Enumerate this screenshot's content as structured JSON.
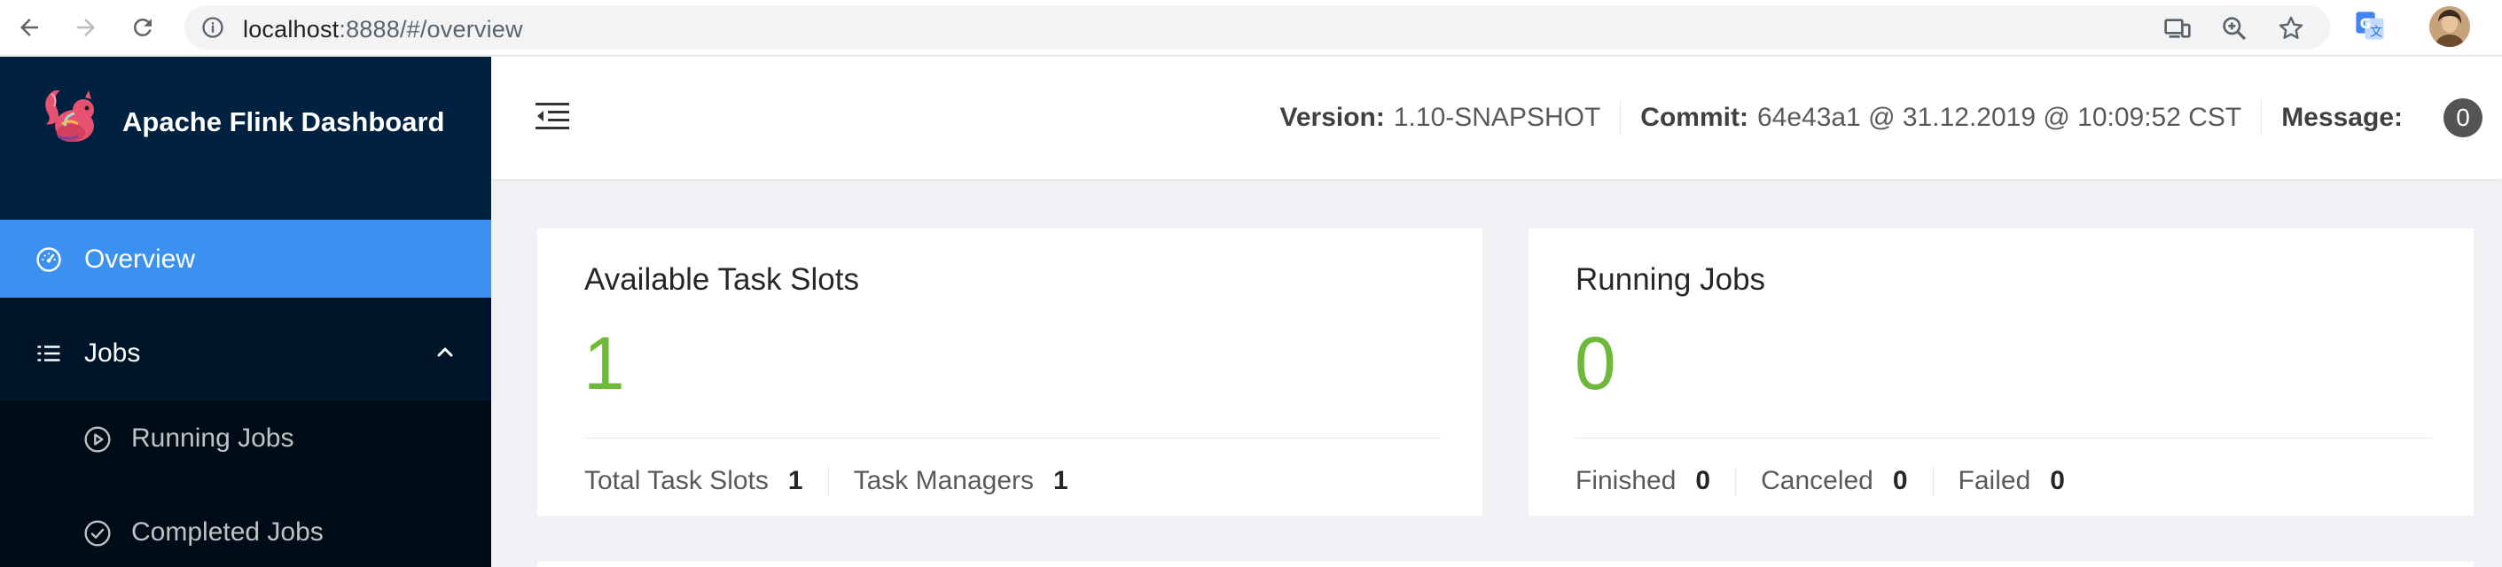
{
  "browser": {
    "url_host": "localhost",
    "url_path": ":8888/#/overview",
    "icons": [
      "back-icon",
      "forward-icon",
      "reload-icon",
      "info-icon",
      "cast-icon",
      "zoom-icon",
      "star-icon",
      "translate-icon",
      "profile-avatar"
    ]
  },
  "sidebar": {
    "brand_title": "Apache Flink Dashboard",
    "items": [
      {
        "label": "Overview",
        "icon": "dashboard-icon",
        "active": true
      },
      {
        "label": "Jobs",
        "icon": "list-icon",
        "expanded": true
      }
    ],
    "subitems": [
      {
        "label": "Running Jobs",
        "icon": "play-circle-icon"
      },
      {
        "label": "Completed Jobs",
        "icon": "check-circle-icon"
      }
    ]
  },
  "header": {
    "version_label": "Version:",
    "version_value": "1.10-SNAPSHOT",
    "commit_label": "Commit:",
    "commit_value": "64e43a1 @ 31.12.2019 @ 10:09:52 CST",
    "message_label": "Message:",
    "message_count": "0"
  },
  "cards": {
    "slots": {
      "title": "Available Task Slots",
      "value": "1",
      "total_label": "Total Task Slots",
      "total_value": "1",
      "managers_label": "Task Managers",
      "managers_value": "1"
    },
    "jobs": {
      "title": "Running Jobs",
      "value": "0",
      "finished_label": "Finished",
      "finished_value": "0",
      "canceled_label": "Canceled",
      "canceled_value": "0",
      "failed_label": "Failed",
      "failed_value": "0"
    }
  },
  "colors": {
    "sidebar_bg": "#001529",
    "brand_bg": "#002140",
    "active_item": "#3c91f0",
    "value_green": "#6fb93a",
    "badge_bg": "#545454"
  }
}
